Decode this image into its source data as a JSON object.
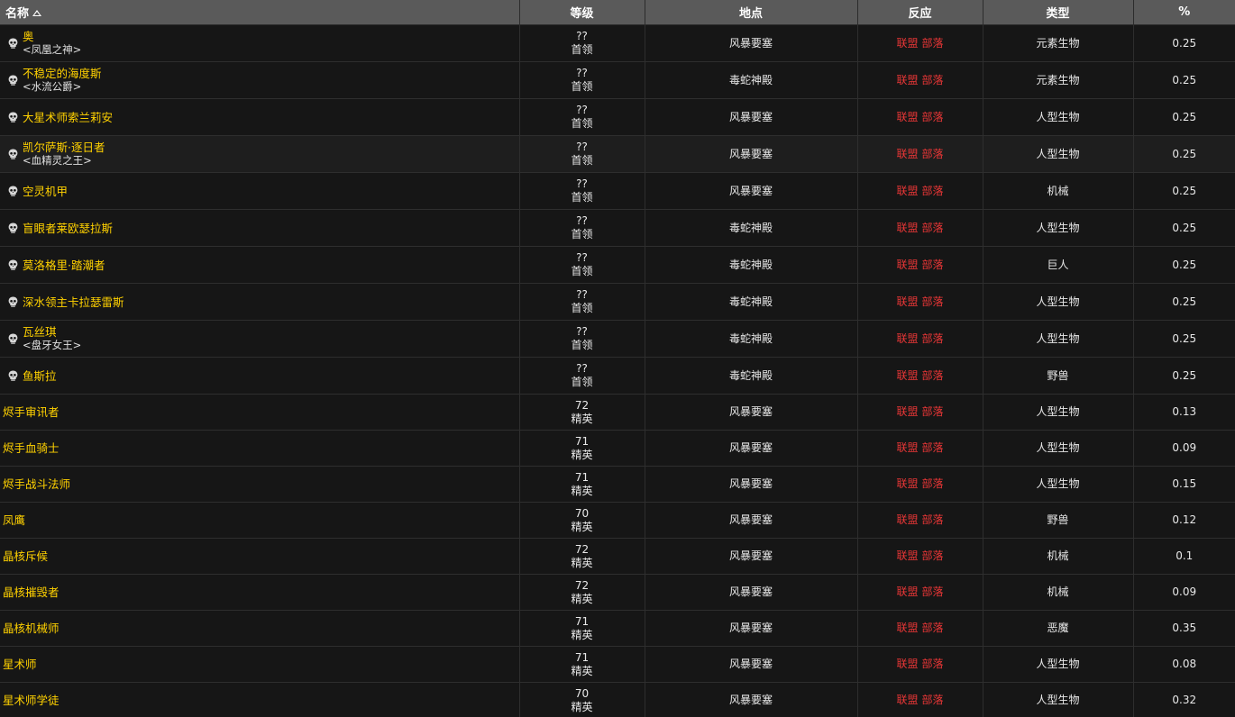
{
  "header": {
    "name": "名称",
    "level": "等级",
    "location": "地点",
    "reaction": "反应",
    "type": "类型",
    "percent": "%"
  },
  "reaction_labels": {
    "alliance": "联盟",
    "horde": "部落"
  },
  "colors": {
    "npc_name": "#ffd100",
    "reaction": "#e83636",
    "header_bg": "#5a5a5a",
    "row_bg": "#161616"
  },
  "rows": [
    {
      "boss": true,
      "name": "奥",
      "tag": "<凤凰之神>",
      "level": "??",
      "class": "首领",
      "location": "风暴要塞",
      "type": "元素生物",
      "pct": "0.25"
    },
    {
      "boss": true,
      "name": "不稳定的海度斯",
      "tag": "<水流公爵>",
      "level": "??",
      "class": "首领",
      "location": "毒蛇神殿",
      "type": "元素生物",
      "pct": "0.25"
    },
    {
      "boss": true,
      "name": "大星术师索兰莉安",
      "tag": "",
      "level": "??",
      "class": "首领",
      "location": "风暴要塞",
      "type": "人型生物",
      "pct": "0.25"
    },
    {
      "boss": true,
      "name": "凯尔萨斯·逐日者",
      "tag": "<血精灵之王>",
      "level": "??",
      "class": "首领",
      "location": "风暴要塞",
      "type": "人型生物",
      "pct": "0.25",
      "highlight": true
    },
    {
      "boss": true,
      "name": "空灵机甲",
      "tag": "",
      "level": "??",
      "class": "首领",
      "location": "风暴要塞",
      "type": "机械",
      "pct": "0.25"
    },
    {
      "boss": true,
      "name": "盲眼者莱欧瑟拉斯",
      "tag": "",
      "level": "??",
      "class": "首领",
      "location": "毒蛇神殿",
      "type": "人型生物",
      "pct": "0.25"
    },
    {
      "boss": true,
      "name": "莫洛格里·踏潮者",
      "tag": "",
      "level": "??",
      "class": "首领",
      "location": "毒蛇神殿",
      "type": "巨人",
      "pct": "0.25"
    },
    {
      "boss": true,
      "name": "深水领主卡拉瑟雷斯",
      "tag": "",
      "level": "??",
      "class": "首领",
      "location": "毒蛇神殿",
      "type": "人型生物",
      "pct": "0.25"
    },
    {
      "boss": true,
      "name": "瓦丝琪",
      "tag": "<盘牙女王>",
      "level": "??",
      "class": "首领",
      "location": "毒蛇神殿",
      "type": "人型生物",
      "pct": "0.25"
    },
    {
      "boss": true,
      "name": "鱼斯拉",
      "tag": "",
      "level": "??",
      "class": "首领",
      "location": "毒蛇神殿",
      "type": "野兽",
      "pct": "0.25"
    },
    {
      "boss": false,
      "name": "烬手审讯者",
      "tag": "",
      "level": "72",
      "class": "精英",
      "location": "风暴要塞",
      "type": "人型生物",
      "pct": "0.13"
    },
    {
      "boss": false,
      "name": "烬手血骑士",
      "tag": "",
      "level": "71",
      "class": "精英",
      "location": "风暴要塞",
      "type": "人型生物",
      "pct": "0.09"
    },
    {
      "boss": false,
      "name": "烬手战斗法师",
      "tag": "",
      "level": "71",
      "class": "精英",
      "location": "风暴要塞",
      "type": "人型生物",
      "pct": "0.15"
    },
    {
      "boss": false,
      "name": "凤鹰",
      "tag": "",
      "level": "70",
      "class": "精英",
      "location": "风暴要塞",
      "type": "野兽",
      "pct": "0.12"
    },
    {
      "boss": false,
      "name": "晶核斥候",
      "tag": "",
      "level": "72",
      "class": "精英",
      "location": "风暴要塞",
      "type": "机械",
      "pct": "0.1"
    },
    {
      "boss": false,
      "name": "晶核摧毁者",
      "tag": "",
      "level": "72",
      "class": "精英",
      "location": "风暴要塞",
      "type": "机械",
      "pct": "0.09"
    },
    {
      "boss": false,
      "name": "晶核机械师",
      "tag": "",
      "level": "71",
      "class": "精英",
      "location": "风暴要塞",
      "type": "恶魔",
      "pct": "0.35"
    },
    {
      "boss": false,
      "name": "星术师",
      "tag": "",
      "level": "71",
      "class": "精英",
      "location": "风暴要塞",
      "type": "人型生物",
      "pct": "0.08"
    },
    {
      "boss": false,
      "name": "星术师学徒",
      "tag": "",
      "level": "70",
      "class": "精英",
      "location": "风暴要塞",
      "type": "人型生物",
      "pct": "0.32"
    }
  ]
}
